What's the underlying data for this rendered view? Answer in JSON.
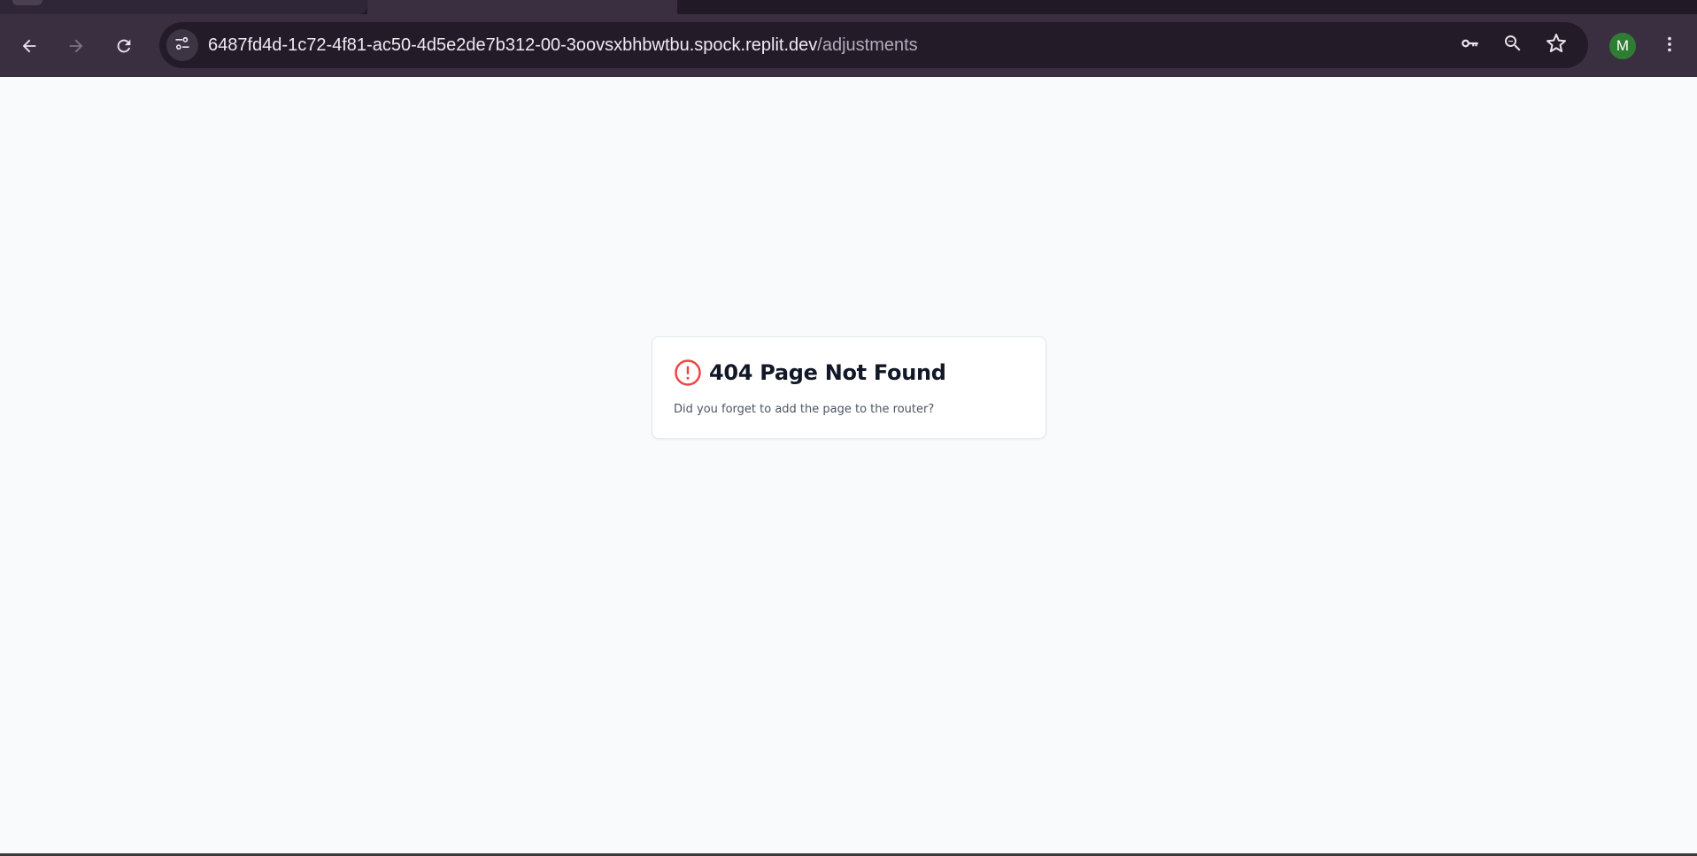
{
  "browser": {
    "url_host": "6487fd4d-1c72-4f81-ac50-4d5e2de7b312-00-3oovsxbhbwtbu.spock.replit.dev",
    "url_path": "/adjustments",
    "profile_initial": "M",
    "icons": {
      "back": "arrow-left-icon",
      "forward": "arrow-right-icon",
      "reload": "reload-icon",
      "site_info": "tune-icon",
      "password": "key-icon",
      "zoom": "zoom-out-icon",
      "bookmark": "star-icon",
      "menu": "kebab-menu-icon"
    },
    "colors": {
      "frame": "#3a2f41",
      "omnibox": "#231c28",
      "avatar": "#2e7d32"
    }
  },
  "page": {
    "title": "404 Page Not Found",
    "message": "Did you forget to add the page to the router?",
    "icon": "alert-circle-icon",
    "colors": {
      "background": "#f8fafc",
      "icon": "#ef4444",
      "title": "#111827",
      "message": "#4b5563"
    }
  }
}
